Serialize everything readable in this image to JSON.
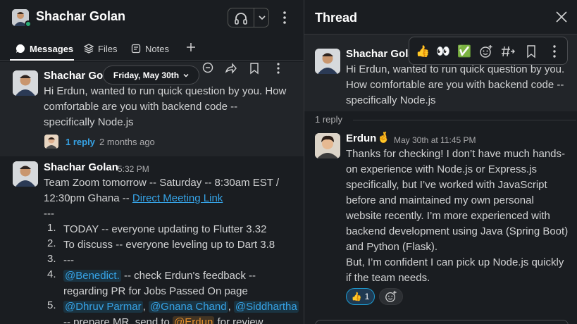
{
  "channel": {
    "name": "Shachar Golan",
    "tabs": [
      {
        "label": "Messages"
      },
      {
        "label": "Files"
      },
      {
        "label": "Notes"
      }
    ],
    "date_pill": "Friday, May 30th"
  },
  "messages": [
    {
      "sender": "Shachar Golan",
      "text_lines": [
        "Hi Erdun, wanted to run quick question by you. How",
        "comfortable are you with backend code --",
        "specifically Node.js"
      ],
      "reply_label": "1 reply",
      "reply_ago": "2 months ago"
    },
    {
      "sender": "Shachar Golan",
      "time": "5:32 PM",
      "line1": "Team Zoom tomorrow -- Saturday -- 8:30am EST /",
      "line2_prefix": "12:30pm Ghana -- ",
      "line2_link": "Direct Meeting Link",
      "separator": "---",
      "list": [
        {
          "num": "1.",
          "text": "TODAY -- everyone updating to Flutter 3.32"
        },
        {
          "num": "2.",
          "text": "To discuss -- everyone leveling up to Dart 3.8"
        },
        {
          "num": "3.",
          "text": "---"
        },
        {
          "num": "4.",
          "mention": "@Benedict.",
          "text": " -- check Erdun's feedback --",
          "text2": "regarding PR for Jobs Passed On page"
        },
        {
          "num": "5.",
          "mentions": [
            "@Dhruv Parmar",
            "@Gnana Chand",
            "@Siddhartha"
          ],
          "comma": ",",
          "text2_prefix": "-- prepare MR, send to ",
          "mention_me": "@Erdun",
          "text2_suffix": " for review"
        }
      ]
    }
  ],
  "thread": {
    "title": "Thread",
    "parent": {
      "sender": "Shachar Golan",
      "text_lines": [
        "Hi Erdun, wanted to run quick question by you.",
        "How comfortable are you with backend code --",
        "specifically Node.js"
      ]
    },
    "quick_reactions": [
      "👍",
      "👀",
      "✅"
    ],
    "replies_count": "1 reply",
    "reply": {
      "sender": "Erdun",
      "sender_emoji": "🤞",
      "time": "May 30th at 11:45 PM",
      "text_lines": [
        "Thanks for checking! I don’t have much hands-",
        "on experience with Node.js or Express.js",
        "specifically, but I’ve worked with JavaScript",
        "before and maintained my own personal",
        "website recently. I’m more experienced with",
        "backend development using Java (Spring Boot)",
        "and Python (Flask).",
        "But, I’m confident I can pick up Node.js quickly",
        "if the team needs."
      ],
      "reaction_emoji": "👍",
      "reaction_count": "1"
    }
  },
  "colors": {
    "background": "#1a1d21",
    "hover": "#222529",
    "link": "#36a3e6",
    "presence": "#2bac76",
    "mention_self": "#e8912d"
  }
}
